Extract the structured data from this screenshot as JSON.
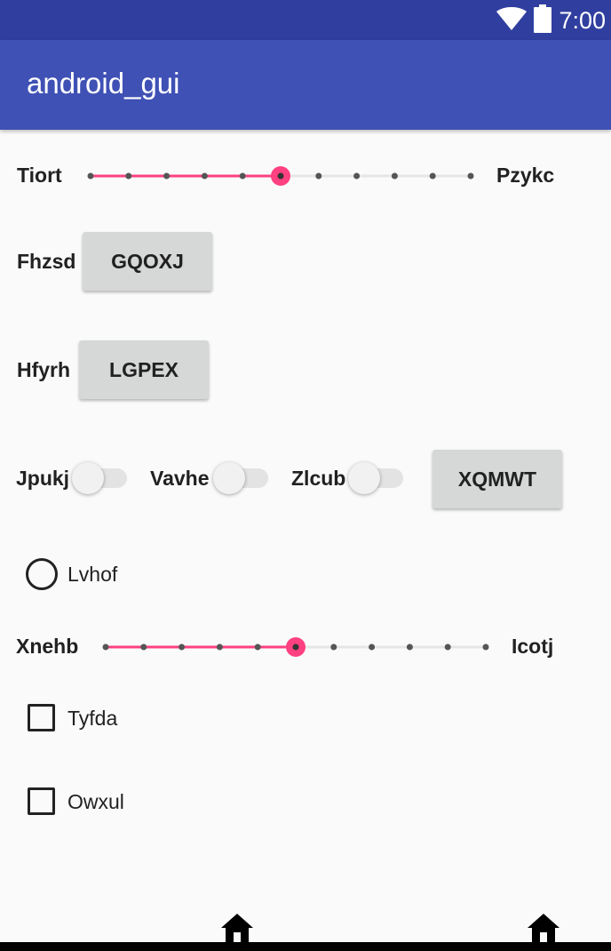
{
  "status_bar": {
    "time": "7:00",
    "icons": [
      "wifi-icon",
      "battery-icon"
    ]
  },
  "app_bar": {
    "title": "android_gui"
  },
  "slider1": {
    "left_label": "Tiort",
    "right_label": "Pzykc",
    "ticks": 11,
    "value": 5
  },
  "row_fhzsd": {
    "label": "Fhzsd",
    "button": "GQOXJ"
  },
  "row_hfyrh": {
    "label": "Hfyrh",
    "button": "LGPEX"
  },
  "switch_row": {
    "switches": [
      {
        "label": "Jpukj",
        "checked": false
      },
      {
        "label": "Vavhe",
        "checked": false
      },
      {
        "label": "Zlcub",
        "checked": false
      }
    ],
    "button": "XQMWT"
  },
  "radio": {
    "label": "Lvhof",
    "checked": false
  },
  "slider2": {
    "left_label": "Xnehb",
    "right_label": "Icotj",
    "ticks": 11,
    "value": 5
  },
  "checkboxes": [
    {
      "label": "Tyfda",
      "checked": false
    },
    {
      "label": "Owxul",
      "checked": false
    }
  ],
  "nav": {
    "icons": [
      "home-icon",
      "home-icon"
    ]
  },
  "colors": {
    "primary": "#3f51b5",
    "primary_dark": "#303f9f",
    "accent": "#ff4081",
    "button_bg": "#d6d7d7",
    "background": "#fafafa"
  }
}
